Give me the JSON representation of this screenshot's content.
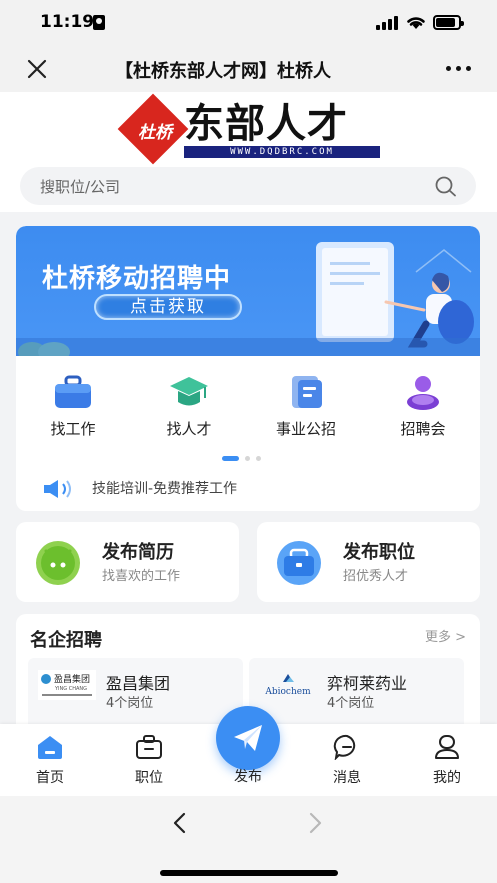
{
  "status": {
    "time": "11:19"
  },
  "nav": {
    "title": "【杜桥东部人才网】杜桥人"
  },
  "logo": {
    "sub": "杜桥",
    "main": "东部人才",
    "url": "WWW.DQDBRC.COM"
  },
  "search": {
    "placeholder": "搜职位/公司"
  },
  "banner": {
    "title": "杜桥移动招聘中",
    "button": "点击获取"
  },
  "menu": [
    {
      "label": "找工作",
      "icon": "briefcase-icon"
    },
    {
      "label": "找人才",
      "icon": "graduation-cap-icon"
    },
    {
      "label": "事业公招",
      "icon": "documents-icon"
    },
    {
      "label": "招聘会",
      "icon": "people-icon"
    }
  ],
  "notice": {
    "text": "技能培训-免费推荐工作"
  },
  "actions": [
    {
      "title": "发布简历",
      "subtitle": "找喜欢的工作",
      "icon": "resume-icon"
    },
    {
      "title": "发布职位",
      "subtitle": "招优秀人才",
      "icon": "job-icon"
    }
  ],
  "famous": {
    "title": "名企招聘",
    "more": "更多 >",
    "companies": [
      {
        "name": "盈昌集团",
        "positions": "4个岗位",
        "logo_text": "盈昌集团",
        "logo_sub": "YING CHANG"
      },
      {
        "name": "弈柯莱药业",
        "positions": "4个岗位",
        "logo_text": "Abiochem"
      }
    ]
  },
  "tabs": [
    {
      "label": "首页",
      "icon": "home-icon"
    },
    {
      "label": "职位",
      "icon": "briefcase-icon"
    },
    {
      "label": "发布",
      "icon": "paper-plane-icon"
    },
    {
      "label": "消息",
      "icon": "message-icon"
    },
    {
      "label": "我的",
      "icon": "user-icon"
    }
  ],
  "colors": {
    "primary": "#3b8ef3",
    "logo_red": "#d8261e",
    "green": "#7cc43c"
  }
}
